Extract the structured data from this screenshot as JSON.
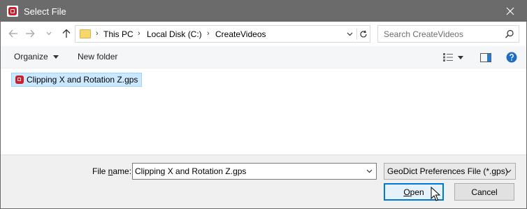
{
  "window": {
    "title": "Select File"
  },
  "address": {
    "crumbs": [
      "This PC",
      "Local Disk (C:)",
      "CreateVideos"
    ]
  },
  "search": {
    "placeholder": "Search CreateVideos"
  },
  "toolbar": {
    "organize_label": "Organize",
    "new_folder_label": "New folder"
  },
  "files": [
    {
      "name": "Clipping X and Rotation Z.gps",
      "selected": true
    }
  ],
  "bottom": {
    "filename_label_prefix": "File ",
    "filename_label_underlined": "n",
    "filename_label_suffix": "ame:",
    "filename_value": "Clipping X and Rotation Z.gps",
    "filetype_value": "GeoDict Preferences File (*.gps)",
    "open_label_underlined": "O",
    "open_label_rest": "pen",
    "cancel_label": "Cancel"
  },
  "colors": {
    "titlebar": "#6b6b6b",
    "selection": "#cce8ff",
    "selection_border": "#99d1ff",
    "primary_border": "#0078d7",
    "app_icon": "#c8202f"
  }
}
